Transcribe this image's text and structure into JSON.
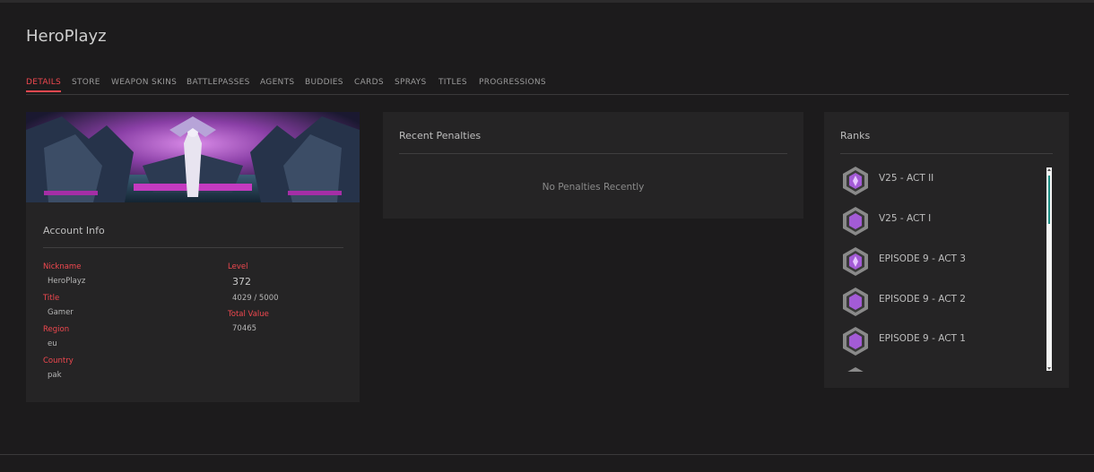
{
  "page": {
    "title": "HeroPlayz"
  },
  "tabs": [
    {
      "label": "DETAILS",
      "active": true
    },
    {
      "label": "STORE"
    },
    {
      "label": "WEAPON SKINS"
    },
    {
      "label": "BATTLEPASSES"
    },
    {
      "label": "AGENTS"
    },
    {
      "label": "BUDDIES"
    },
    {
      "label": "CARDS"
    },
    {
      "label": "SPRAYS"
    },
    {
      "label": "TITLES"
    },
    {
      "label": "PROGRESSIONS"
    }
  ],
  "account": {
    "title": "Account Info",
    "nickname_label": "Nickname",
    "nickname": "HeroPlayz",
    "title_label": "Title",
    "player_title": "Gamer",
    "region_label": "Region",
    "region": "eu",
    "country_label": "Country",
    "country": "pak",
    "level_label": "Level",
    "level": "372",
    "xp": "4029 / 5000",
    "total_value_label": "Total Value",
    "total_value": "70465"
  },
  "penalties": {
    "title": "Recent Penalties",
    "empty_text": "No Penalties Recently"
  },
  "ranks": {
    "title": "Ranks",
    "items": [
      {
        "label": "V25 - ACT II",
        "icon": "ascendant-rank-icon"
      },
      {
        "label": "V25 - ACT I",
        "icon": "ascendant-rank-icon"
      },
      {
        "label": "EPISODE 9 - ACT 3",
        "icon": "ascendant-rank-icon"
      },
      {
        "label": "EPISODE 9 - ACT 2",
        "icon": "ascendant-rank-icon"
      },
      {
        "label": "EPISODE 9 - ACT 1",
        "icon": "ascendant-rank-icon"
      },
      {
        "label": "",
        "icon": "ascendant-rank-icon"
      }
    ]
  },
  "colors": {
    "accent": "#f0484f",
    "rank_purple": "#a35bd6",
    "scroll_thumb": "#1f8f85"
  }
}
